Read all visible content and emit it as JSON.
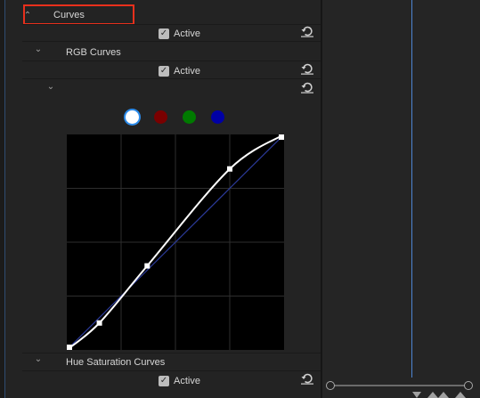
{
  "effects": {
    "curves": {
      "label": "Curves",
      "active_label": "Active",
      "active": true
    },
    "rgb_curves": {
      "label": "RGB Curves",
      "active_label": "Active",
      "active": true,
      "channels": [
        {
          "name": "master-channel",
          "color": "#ffffff",
          "selected": true
        },
        {
          "name": "red-channel",
          "color": "#7a0000",
          "selected": false
        },
        {
          "name": "green-channel",
          "color": "#007a00",
          "selected": false
        },
        {
          "name": "blue-channel",
          "color": "#0000a5",
          "selected": false
        }
      ],
      "curve": {
        "points": [
          [
            0,
            0
          ],
          [
            0.15,
            0.125
          ],
          [
            0.37,
            0.39
          ],
          [
            0.75,
            0.84
          ],
          [
            1,
            1
          ]
        ],
        "curve_color": "#ffffff",
        "diagonal_color": "#2b3a9a",
        "grid_color": "#2e2e2e"
      }
    },
    "hue_saturation_curves": {
      "label": "Hue Saturation Curves",
      "active_label": "Active",
      "active": true
    }
  },
  "colors": {
    "highlight": "#e8301c",
    "accent": "#2d8ceb",
    "timeline_marker": "#4d85d2"
  }
}
